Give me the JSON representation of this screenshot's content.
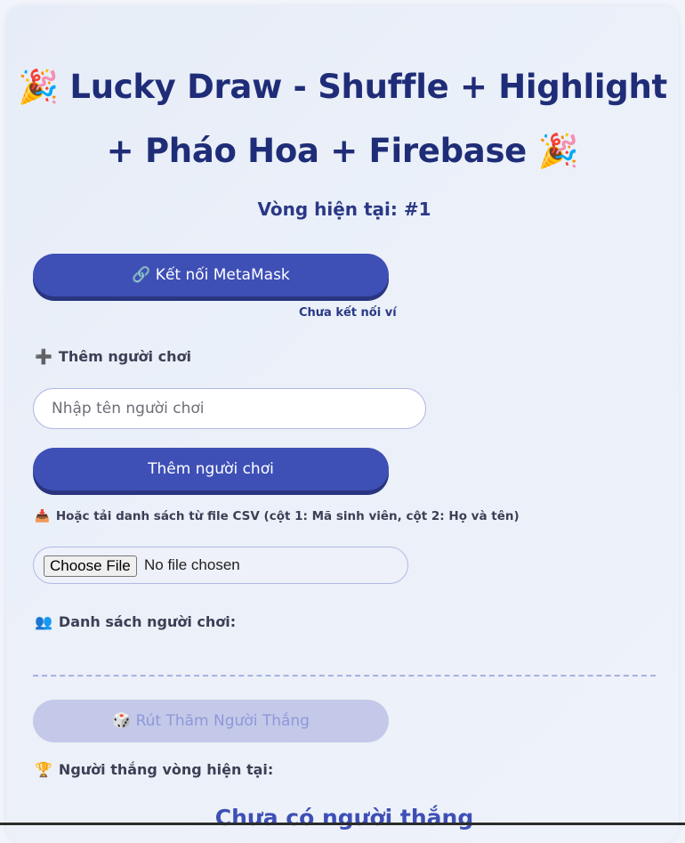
{
  "header": {
    "title_line1": "🎉 Lucky Draw - Shuffle + Highlight",
    "title_line2": "+ Pháo Hoa + Firebase 🎉",
    "round_text": "Vòng hiện tại: #1"
  },
  "wallet": {
    "connect_button": "🔗 Kết nối MetaMask",
    "status": "Chưa kết nối ví"
  },
  "add_player": {
    "section_icon": "➕",
    "section_label": "Thêm người chơi",
    "name_placeholder": "Nhập tên người chơi",
    "name_value": "",
    "add_button": "Thêm người chơi"
  },
  "csv_upload": {
    "section_icon": "📥",
    "section_label": "Hoặc tải danh sách từ file CSV (cột 1: Mã sinh viên, cột 2: Họ và tên)",
    "choose_button": "Choose File",
    "file_status": "No file chosen"
  },
  "players": {
    "section_icon": "👥",
    "section_label": "Danh sách người chơi:",
    "items": []
  },
  "draw": {
    "button": "🎲 Rút Thăm Người Thắng",
    "disabled": true
  },
  "winner": {
    "section_icon": "🏆",
    "section_label": "Người thắng vòng hiện tại:",
    "text": "Chưa có người thắng"
  },
  "colors": {
    "accent": "#3e4fb6",
    "title": "#1f2d78",
    "disabled_button": "#c4c9e9"
  }
}
